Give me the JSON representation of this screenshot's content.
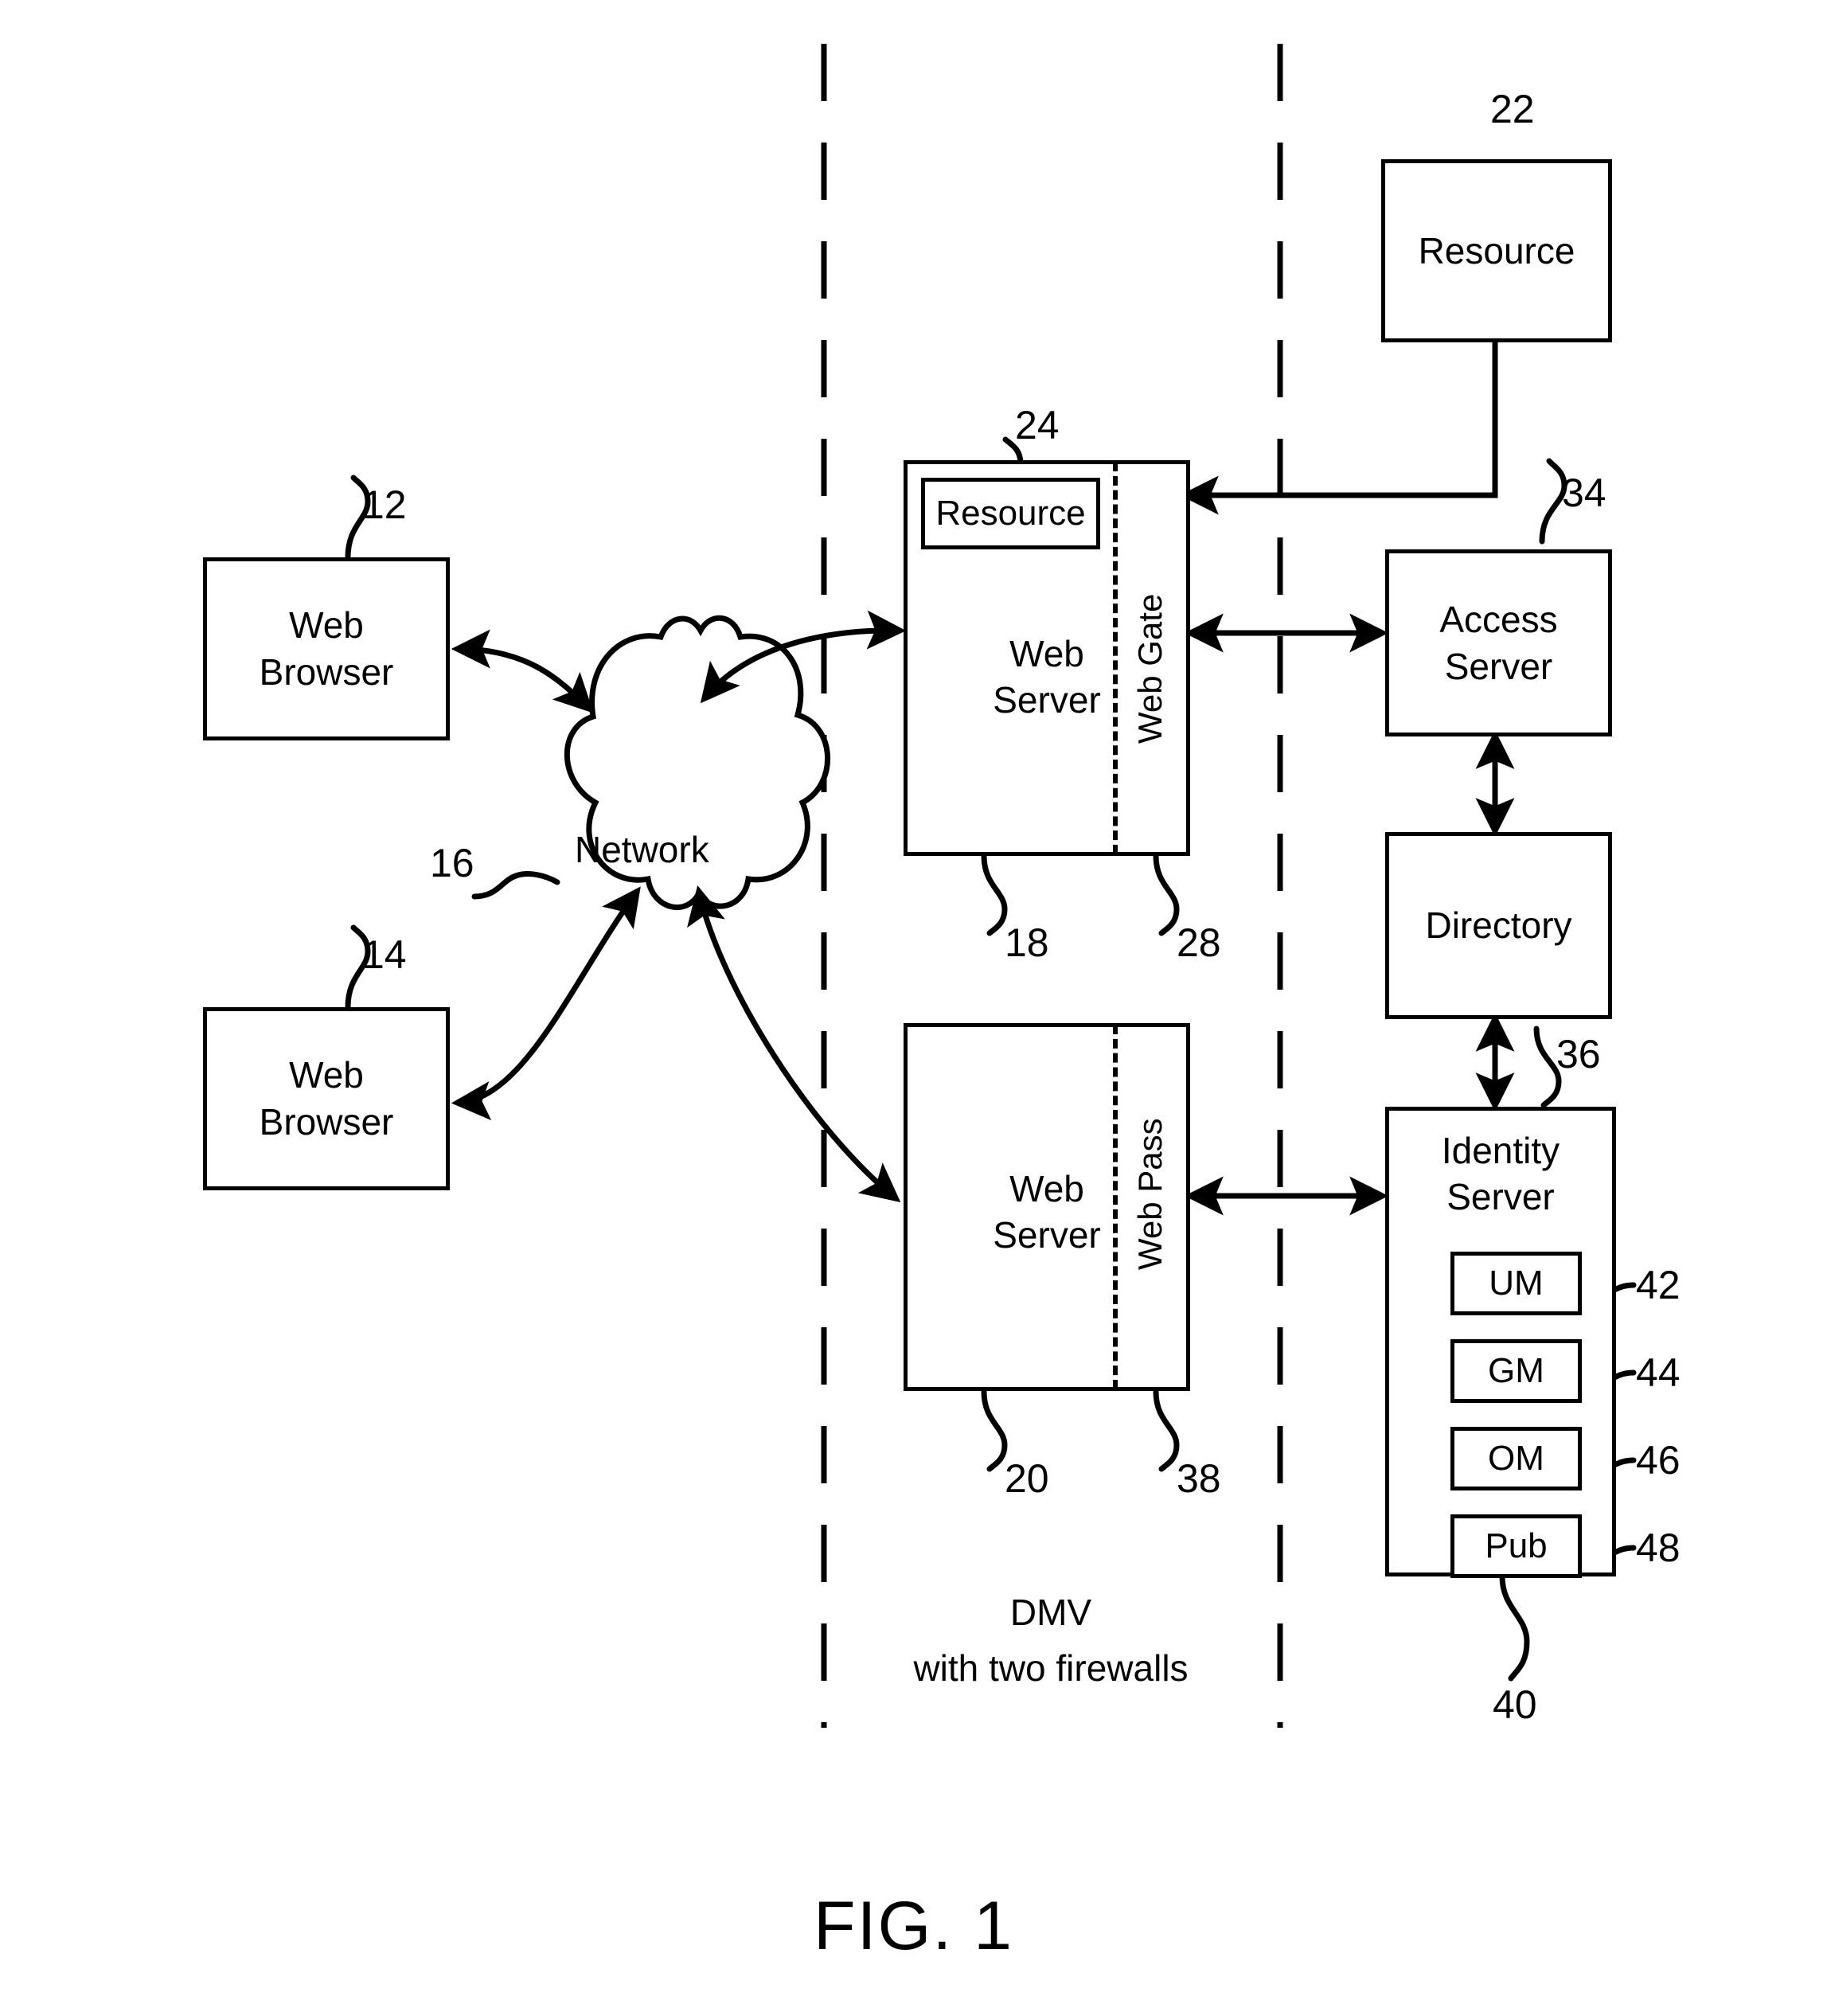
{
  "figure": {
    "caption": "FIG. 1",
    "zone_note_line1": "DMV",
    "zone_note_line2": "with  two firewalls"
  },
  "nodes": {
    "web_browser_top": {
      "label_line1": "Web",
      "label_line2": "Browser",
      "ref": "12"
    },
    "web_browser_bottom": {
      "label_line1": "Web",
      "label_line2": "Browser",
      "ref": "14"
    },
    "network": {
      "label": "Network",
      "ref": "16"
    },
    "web_server_top": {
      "label_line1": "Web",
      "label_line2": "Server",
      "ref": "18"
    },
    "web_gate": {
      "label": "Web Gate",
      "ref": "28"
    },
    "resource_in_server": {
      "label": "Resource",
      "ref": "24"
    },
    "resource_external": {
      "label": "Resource",
      "ref": "22"
    },
    "access_server": {
      "label_line1": "Access",
      "label_line2": "Server",
      "ref": "34"
    },
    "directory": {
      "label": "Directory",
      "ref": "36"
    },
    "web_server_bottom": {
      "label_line1": "Web",
      "label_line2": "Server",
      "ref": "20"
    },
    "web_pass": {
      "label": "Web Pass",
      "ref": "38"
    },
    "identity_server": {
      "label_line1": "Identity",
      "label_line2": "Server",
      "ref": "40"
    },
    "identity_modules": [
      {
        "label": "UM",
        "ref": "42"
      },
      {
        "label": "GM",
        "ref": "44"
      },
      {
        "label": "OM",
        "ref": "46"
      },
      {
        "label": "Pub",
        "ref": "48"
      }
    ]
  },
  "firewalls": [
    {
      "name": "outer-firewall"
    },
    {
      "name": "inner-firewall"
    }
  ]
}
